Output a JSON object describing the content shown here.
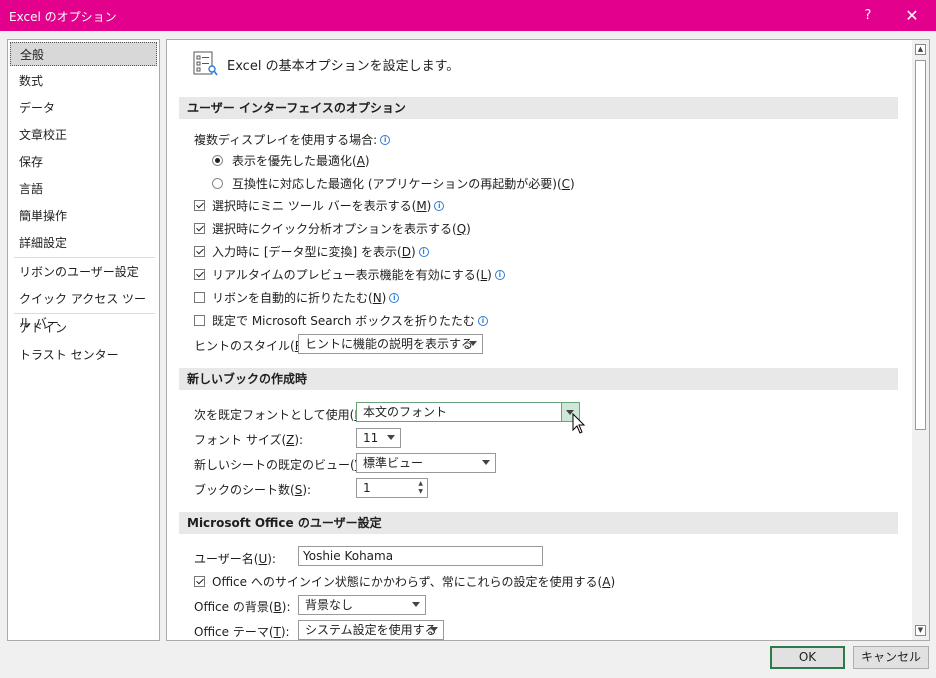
{
  "window": {
    "title": "Excel のオプション",
    "help": "?",
    "close": "✕"
  },
  "sidebar": {
    "items": [
      "全般",
      "数式",
      "データ",
      "文章校正",
      "保存",
      "言語",
      "簡単操作",
      "詳細設定",
      "リボンのユーザー設定",
      "クイック アクセス ツール バー",
      "アドイン",
      "トラスト センター"
    ],
    "active": "全般"
  },
  "header": {
    "text": "Excel の基本オプションを設定します。"
  },
  "sections": {
    "ui": "ユーザー インターフェイスのオプション",
    "newbook": "新しいブックの作成時",
    "office": "Microsoft Office のユーザー設定"
  },
  "ui": {
    "multi_display": "複数ディスプレイを使用する場合:",
    "radio1": {
      "text": "表示を優先した最適化(",
      "key": "A",
      "end": ")"
    },
    "radio2": {
      "text": "互換性に対応した最適化 (アプリケーションの再起動が必要)(",
      "key": "C",
      "end": ")"
    },
    "cb_mini": {
      "text": "選択時にミニ ツール バーを表示する(",
      "key": "M",
      "end": ")"
    },
    "cb_quick": {
      "text": "選択時にクイック分析オプションを表示する(",
      "key": "Q",
      "end": ")"
    },
    "cb_datatype": {
      "text": "入力時に [データ型に変換] を表示(",
      "key": "D",
      "end": ")"
    },
    "cb_preview": {
      "text": "リアルタイムのプレビュー表示機能を有効にする(",
      "key": "L",
      "end": ")"
    },
    "cb_ribbon": {
      "text": "リボンを自動的に折りたたむ(",
      "key": "N",
      "end": ")"
    },
    "cb_search": {
      "text": "既定で Microsoft Search ボックスを折りたたむ"
    },
    "tip_label": {
      "text": "ヒントのスタイル(",
      "key": "R",
      "end": "):"
    },
    "tip_value": "ヒントに機能の説明を表示する"
  },
  "newbook": {
    "font_label": {
      "text": "次を既定フォントとして使用(",
      "key": "N",
      "end": "):"
    },
    "font_value": "本文のフォント",
    "size_label": {
      "text": "フォント サイズ(",
      "key": "Z",
      "end": "):"
    },
    "size_value": "11",
    "view_label": {
      "text": "新しいシートの既定のビュー(",
      "key": "V",
      "end": "):"
    },
    "view_value": "標準ビュー",
    "sheets_label": {
      "text": "ブックのシート数(",
      "key": "S",
      "end": "):"
    },
    "sheets_value": "1"
  },
  "office": {
    "user_label": {
      "text": "ユーザー名(",
      "key": "U",
      "end": "):"
    },
    "user_value": "Yoshie Kohama",
    "cb_always": {
      "text": "Office へのサインイン状態にかかわらず、常にこれらの設定を使用する(",
      "key": "A",
      "end": ")"
    },
    "bg_label": {
      "text": "Office の背景(",
      "key": "B",
      "end": "):"
    },
    "bg_value": "背景なし",
    "theme_label": {
      "text": "Office テーマ(",
      "key": "T",
      "end": "):"
    },
    "theme_value": "システム設定を使用する"
  },
  "buttons": {
    "ok": "OK",
    "cancel": "キャンセル"
  }
}
